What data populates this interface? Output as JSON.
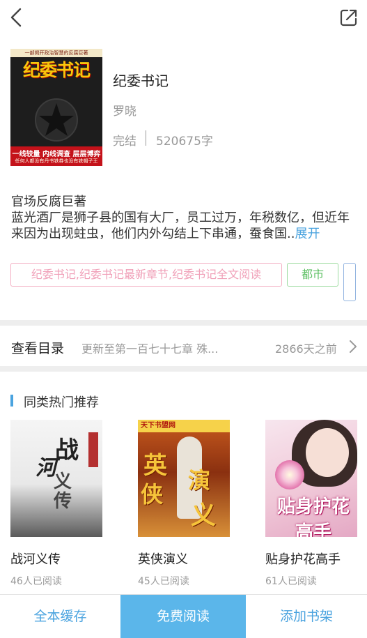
{
  "topbar": {
    "back_icon": "chevron-left-icon",
    "share_icon": "share-icon"
  },
  "book": {
    "cover": {
      "top_text": "一部揭开政治智慧的反腐巨著",
      "title": "纪委书记",
      "band_line1": "一线较量 内线调查 层层博弈",
      "band_line2": "任何人都没有丹书铁券也没有铁帽子王"
    },
    "title": "纪委书记",
    "author": "罗晓",
    "status": "完结",
    "word_count": "520675字"
  },
  "intro": {
    "line1": "官场反腐巨著",
    "text": "蓝光酒厂是狮子县的国有大厂，员工过万，年税数亿，但近年来因为出现蛀虫，他们内外勾结上下串通，蚕食国..",
    "expand_label": "展开"
  },
  "tags": {
    "keywords": "纪委书记,纪委书记最新章节,纪委书记全文阅读",
    "category": "都市"
  },
  "toc": {
    "label": "查看目录",
    "latest": "更新至第一百七十七章 殊...",
    "time": "2866天之前"
  },
  "recommend": {
    "title": "同类热门推荐",
    "items": [
      {
        "name": "战河义传",
        "readers": "46人已阅读",
        "cover_text": "战河义传"
      },
      {
        "name": "英侠演义",
        "readers": "45人已阅读",
        "cover_text": "英侠演义",
        "cover_logo": "天下书盟网"
      },
      {
        "name": "贴身护花高手",
        "readers": "61人已阅读",
        "cover_text": "贴身护花高手"
      }
    ]
  },
  "bottom": {
    "cache_label": "全本缓存",
    "read_label": "免费阅读",
    "shelf_label": "添加书架"
  },
  "colors": {
    "accent": "#4aa3df",
    "primary_button": "#5bb6ea",
    "tag_pink": "#f0a0b8",
    "tag_green": "#5ec064"
  }
}
